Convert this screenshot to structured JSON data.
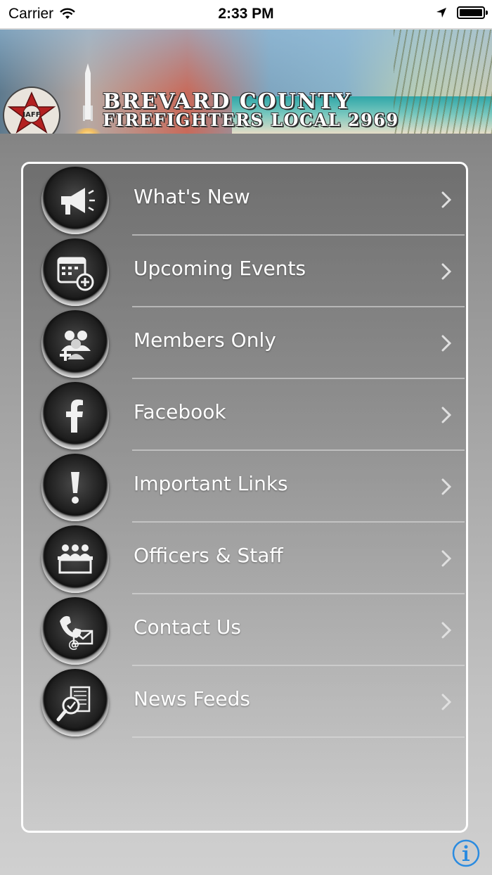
{
  "status_bar": {
    "carrier": "Carrier",
    "time": "2:33 PM"
  },
  "header": {
    "title": "BREVARD COUNTY",
    "subtitle": "FIREFIGHTERS LOCAL 2969",
    "logo_text": "BREVARD COUNTY FIREFIGHTERS IAFF"
  },
  "menu": {
    "items": [
      {
        "label": "What's New",
        "icon": "megaphone-icon"
      },
      {
        "label": "Upcoming Events",
        "icon": "calendar-add-icon"
      },
      {
        "label": "Members Only",
        "icon": "members-add-icon"
      },
      {
        "label": "Facebook",
        "icon": "facebook-icon"
      },
      {
        "label": "Important Links",
        "icon": "exclamation-icon"
      },
      {
        "label": "Officers & Staff",
        "icon": "officers-podium-icon"
      },
      {
        "label": "Contact Us",
        "icon": "phone-mail-icon"
      },
      {
        "label": "News Feeds",
        "icon": "news-search-icon"
      }
    ]
  },
  "colors": {
    "accent": "#2a8be0",
    "label": "#ffffff",
    "panel_border": "#ffffff"
  }
}
